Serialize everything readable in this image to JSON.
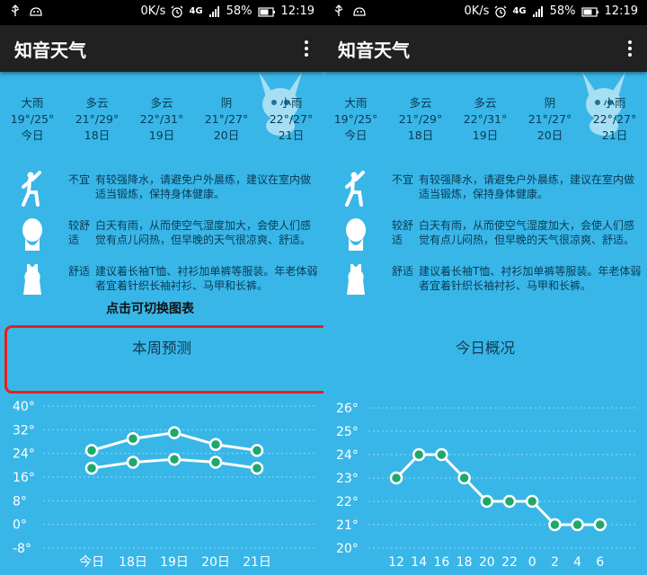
{
  "status_bar": {
    "speed": "0K/s",
    "network": "4G",
    "battery": "58%",
    "time": "12:19"
  },
  "app_title": "知音天气",
  "forecast": [
    {
      "condition": "大雨",
      "temp": "19°/25°",
      "day": "今日",
      "icon": "heavy-rain"
    },
    {
      "condition": "多云",
      "temp": "21°/29°",
      "day": "18日",
      "icon": "sun-cloud"
    },
    {
      "condition": "多云",
      "temp": "22°/31°",
      "day": "19日",
      "icon": "sun-cloud"
    },
    {
      "condition": "阴",
      "temp": "21°/27°",
      "day": "20日",
      "icon": "overcast"
    },
    {
      "condition": "小雨",
      "temp": "22°/27°",
      "day": "21日",
      "icon": "light-rain"
    }
  ],
  "advice": [
    {
      "icon": "exercise-icon",
      "level": "不宜",
      "text": "有较强降水，请避免户外晨练，建议在室内做适当锻炼，保持身体健康。"
    },
    {
      "icon": "comfort-icon",
      "level": "较舒适",
      "text": "白天有雨，从而使空气湿度加大，会使人们感觉有点儿闷热，但早晚的天气很凉爽、舒适。"
    },
    {
      "icon": "clothing-icon",
      "level": "舒适",
      "text": "建议着长袖T恤、衬衫加单裤等服装。年老体弱者宜着针织长袖衬衫、马甲和长裤。"
    }
  ],
  "hint": "点击可切换图表",
  "left_card_title": "本周预测",
  "right_card_title": "今日概况",
  "colors": {
    "background": "#39b6e8",
    "appbar": "#212121",
    "highlight": "#e8201c",
    "line": "#ffffff",
    "marker_fill": "#1fa86b"
  },
  "chart_data": [
    {
      "type": "line",
      "title": "本周预测",
      "categories": [
        "今日",
        "18日",
        "19日",
        "20日",
        "21日"
      ],
      "y_ticks": [
        "40°",
        "32°",
        "24°",
        "16°",
        "8°",
        "0°",
        "-8°"
      ],
      "ylim": [
        -8,
        40
      ],
      "series": [
        {
          "values": [
            25,
            29,
            31,
            27,
            25
          ]
        },
        {
          "values": [
            19,
            21,
            22,
            21,
            19
          ]
        }
      ],
      "grid": "dotted-horizontal"
    },
    {
      "type": "line",
      "title": "今日概况",
      "categories": [
        "12",
        "14",
        "16",
        "18",
        "20",
        "22",
        "0",
        "2",
        "4",
        "6"
      ],
      "y_ticks": [
        "26°",
        "25°",
        "24°",
        "23°",
        "22°",
        "21°",
        "20°"
      ],
      "ylim": [
        20,
        26
      ],
      "series": [
        {
          "values": [
            23,
            24,
            24,
            23,
            22,
            22,
            22,
            21,
            21,
            21
          ]
        }
      ],
      "grid": "dotted-horizontal"
    }
  ]
}
